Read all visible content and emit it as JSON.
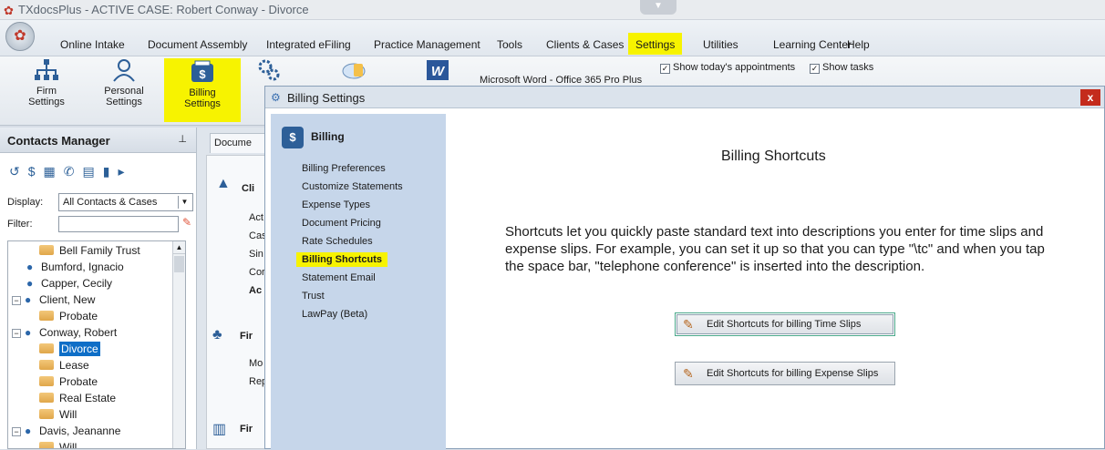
{
  "window": {
    "title": "TXdocsPlus - ACTIVE CASE: Robert Conway - Divorce"
  },
  "menu": [
    "Online Intake",
    "Document Assembly",
    "Integrated eFiling",
    "Practice Management",
    "Tools",
    "Clients & Cases",
    "Settings",
    "Utilities",
    "Learning Center",
    "Help"
  ],
  "ribbon": {
    "firm_settings": "Firm Settings",
    "personal_settings": "Personal Settings",
    "billing_settings": "Billing Settings",
    "word_label": "Microsoft Word - Office 365 Pro Plus",
    "show_appointments": "Show today's appointments",
    "show_tasks": "Show tasks"
  },
  "contacts": {
    "title": "Contacts Manager",
    "display_label": "Display:",
    "display_value": "All Contacts & Cases",
    "filter_label": "Filter:",
    "tree": [
      {
        "type": "case",
        "label": "Bell Family Trust"
      },
      {
        "type": "person",
        "label": "Bumford, Ignacio"
      },
      {
        "type": "person",
        "label": "Capper, Cecily"
      },
      {
        "type": "person",
        "label": "Client, New"
      },
      {
        "type": "case",
        "label": "Probate"
      },
      {
        "type": "person",
        "label": "Conway, Robert"
      },
      {
        "type": "case",
        "label": "Divorce"
      },
      {
        "type": "case",
        "label": "Lease"
      },
      {
        "type": "case",
        "label": "Probate"
      },
      {
        "type": "case",
        "label": "Real Estate"
      },
      {
        "type": "case",
        "label": "Will"
      },
      {
        "type": "person",
        "label": "Davis, Jeananne"
      },
      {
        "type": "case",
        "label": "Will"
      }
    ]
  },
  "doc_tab": "Docume",
  "side_panel": {
    "cli": "Cli",
    "act": "Act",
    "cas": "Cas",
    "sin": "Sin",
    "cor": "Cor",
    "acc": "Ac",
    "fir1": "Fir",
    "mo": "Mo",
    "rep": "Rep",
    "fir2": "Fir"
  },
  "dialog": {
    "title": "Billing Settings",
    "close": "x",
    "nav_header": "Billing",
    "nav_items": [
      "Billing Preferences",
      "Customize Statements",
      "Expense Types",
      "Document Pricing",
      "Rate Schedules",
      "Billing Shortcuts",
      "Statement Email",
      "Trust",
      "LawPay (Beta)"
    ],
    "heading": "Billing Shortcuts",
    "body": "Shortcuts let you quickly paste standard text into descriptions you enter for time slips and expense slips.  For example, you can set it up so that you can type \"\\tc\" and when you tap the space bar, \"telephone conference\" is inserted into the description.",
    "btn_time": "Edit Shortcuts for billing Time Slips",
    "btn_expense": "Edit Shortcuts for billing Expense Slips"
  }
}
